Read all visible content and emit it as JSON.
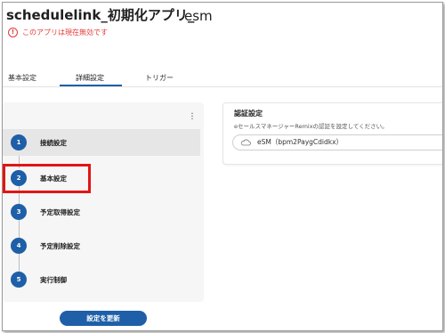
{
  "app": {
    "title": "schedulelink_初期化アプリ_",
    "subtitle": "esm",
    "warning": "このアプリは現在無効です"
  },
  "tabs": [
    {
      "label": "基本設定"
    },
    {
      "label": "詳細設定",
      "active": true
    },
    {
      "label": "トリガー"
    }
  ],
  "steps": [
    {
      "number": "1",
      "label": "接続設定",
      "selected": true
    },
    {
      "number": "2",
      "label": "基本設定"
    },
    {
      "number": "3",
      "label": "予定取得設定"
    },
    {
      "number": "4",
      "label": "予定削除設定"
    },
    {
      "number": "5",
      "label": "実行制御"
    }
  ],
  "update_button": "設定を更新",
  "auth": {
    "title": "認証設定",
    "description": "eセールスマネージャーRemixの認証を設定してください。",
    "value": "eSM（bpm2PaygCdidkx）"
  },
  "colors": {
    "accent": "#1e5fa8",
    "warning": "#e53935",
    "highlight": "#e31414"
  },
  "icons": {
    "warning": "warning-circle-icon",
    "menu": "kebab-menu-icon",
    "auth": "cloud-icon"
  }
}
